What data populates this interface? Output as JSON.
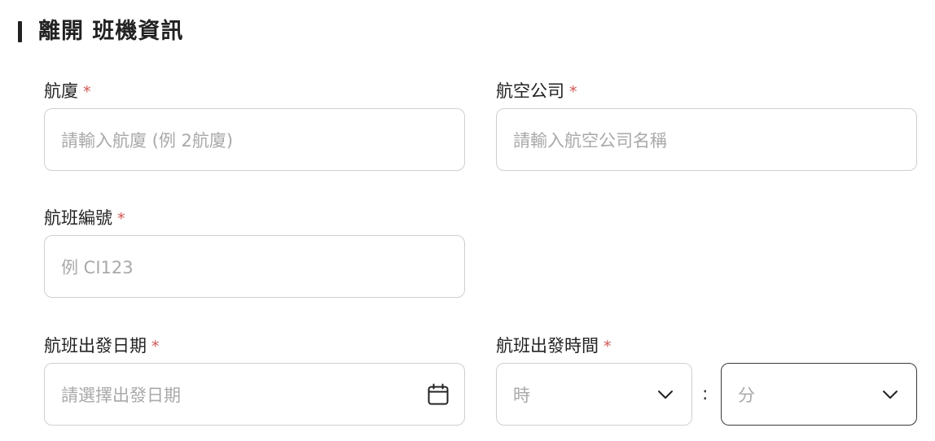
{
  "section": {
    "title": "離開 班機資訊"
  },
  "fields": {
    "terminal": {
      "label": "航廈",
      "required_mark": "*",
      "placeholder": "請輸入航廈 (例 2航廈)"
    },
    "airline": {
      "label": "航空公司",
      "required_mark": "*",
      "placeholder": "請輸入航空公司名稱"
    },
    "flight_number": {
      "label": "航班編號",
      "required_mark": "*",
      "placeholder": "例 CI123"
    },
    "departure_date": {
      "label": "航班出發日期",
      "required_mark": "*",
      "placeholder": "請選擇出發日期",
      "icon": "calendar-icon"
    },
    "departure_time": {
      "label": "航班出發時間",
      "required_mark": "*",
      "hour_placeholder": "時",
      "separator": ":",
      "minute_placeholder": "分",
      "icon": "chevron-down-icon"
    }
  },
  "colors": {
    "required": "#d9534f",
    "placeholder": "#a9a9a9",
    "border": "#cfcfcf",
    "border_focus": "#3a3a3a"
  }
}
